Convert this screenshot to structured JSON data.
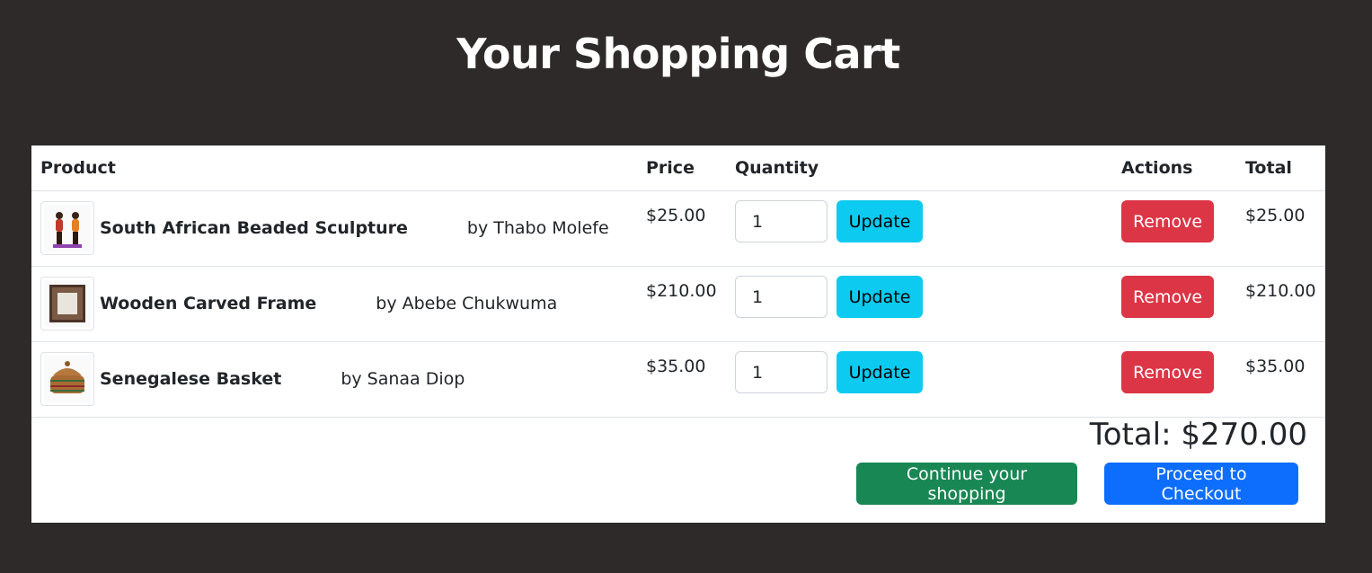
{
  "page": {
    "title": "Your Shopping Cart"
  },
  "table": {
    "headers": {
      "product": "Product",
      "price": "Price",
      "quantity": "Quantity",
      "actions": "Actions",
      "total": "Total"
    },
    "rows": [
      {
        "name": "South African Beaded Sculpture",
        "artist": "by Thabo Molefe",
        "price": "$25.00",
        "quantity": "1",
        "update_label": "Update",
        "remove_label": "Remove",
        "total": "$25.00",
        "image_icon": "beaded-sculpture-image"
      },
      {
        "name": "Wooden Carved Frame",
        "artist": "by Abebe Chukwuma",
        "price": "$210.00",
        "quantity": "1",
        "update_label": "Update",
        "remove_label": "Remove",
        "total": "$210.00",
        "image_icon": "carved-frame-image"
      },
      {
        "name": "Senegalese Basket",
        "artist": "by Sanaa Diop",
        "price": "$35.00",
        "quantity": "1",
        "update_label": "Update",
        "remove_label": "Remove",
        "total": "$35.00",
        "image_icon": "basket-image"
      }
    ]
  },
  "summary": {
    "total_label": "Total: $270.00",
    "continue_label": "Continue your shopping",
    "checkout_label": "Proceed to Checkout"
  },
  "colors": {
    "background": "#2e2a2a",
    "update": "#0dcaf0",
    "remove": "#dc3545",
    "continue": "#198754",
    "checkout": "#0d6efd"
  }
}
